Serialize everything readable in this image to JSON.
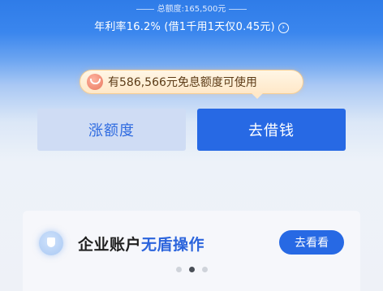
{
  "summary": {
    "total_quota": "总额度:165,500元",
    "rate_text": "年利率16.2% (借1千用1天仅0.45元)",
    "rate_arrow": "›"
  },
  "promo": {
    "text": "有586,566元免息额度可使用"
  },
  "actions": {
    "raise_label": "涨额度",
    "borrow_label": "去借钱"
  },
  "banner": {
    "title_main": "企业账户",
    "title_accent": "无盾操作",
    "button_label": "去看看",
    "page_count": 3,
    "active_page": 2
  },
  "icons": {
    "info": "chevron-right-circle-icon",
    "promo": "coin-icon",
    "banner": "shield-icon"
  },
  "colors": {
    "primary": "#2769e4",
    "secondary_button_bg": "#cfdcf4",
    "promo_bg": "#ffe8c8"
  }
}
